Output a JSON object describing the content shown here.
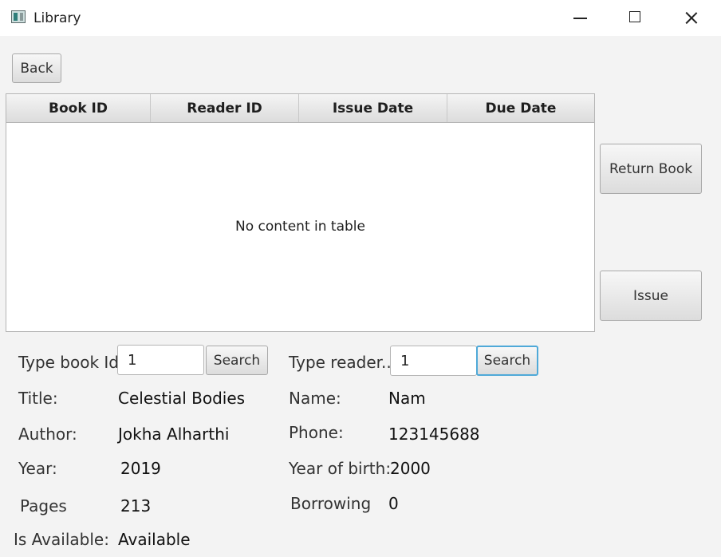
{
  "window": {
    "title": "Library",
    "minimize_icon": "minimize-icon",
    "maximize_icon": "maximize-icon",
    "close_icon": "close-icon"
  },
  "toolbar": {
    "back_label": "Back"
  },
  "loans_table": {
    "columns": [
      "Book ID",
      "Reader ID",
      "Issue Date",
      "Due Date"
    ],
    "rows": [],
    "placeholder": "No content in table"
  },
  "actions": {
    "return_book_label": "Return Book",
    "issue_label": "Issue"
  },
  "book": {
    "search_label": "Type book Id:",
    "search_value": "1",
    "search_button": "Search",
    "title_label": "Title:",
    "title": "Celestial Bodies",
    "author_label": "Author:",
    "author": "Jokha Alharthi",
    "year_label": "Year:",
    "year": "2019",
    "pages_label": "Pages",
    "pages": "213",
    "available_label": "Is Available:",
    "available": "Available"
  },
  "reader": {
    "search_label": "Type reader...",
    "search_value": "1",
    "search_button": "Search",
    "name_label": "Name:",
    "name": "Nam",
    "phone_label": "Phone:",
    "phone": "123145688",
    "birth_label": "Year of birth:",
    "birth": "2000",
    "borrowing_label": "Borrowing",
    "borrowing": "0"
  },
  "colors": {
    "focus": "#4fa9d8",
    "background": "#f3f3f3"
  }
}
